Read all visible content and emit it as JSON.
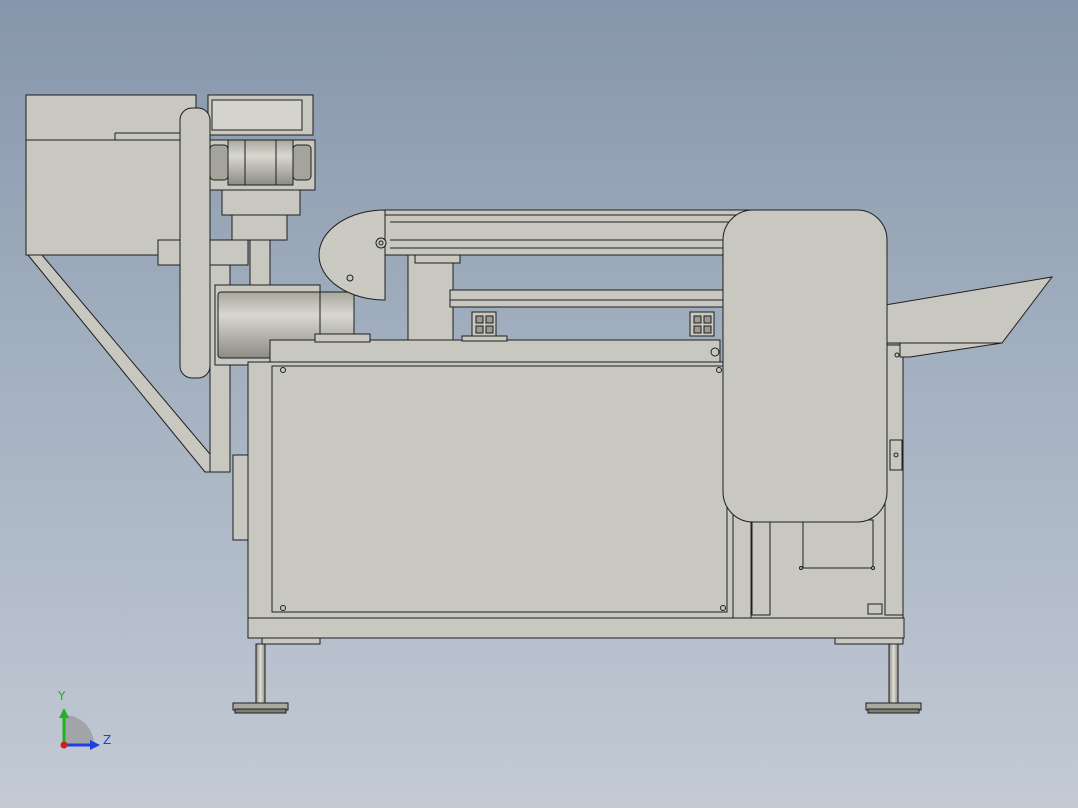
{
  "viewport": {
    "background_top": "#8696ab",
    "background_bottom": "#c3cad4"
  },
  "model": {
    "part_color": "#c8c8c0",
    "part_edge_color": "#1e1e1e",
    "shadow_color": "#9a9a92"
  },
  "triad": {
    "y_label": "Y",
    "z_label": "Z",
    "y_color": "#1fb31f",
    "z_color": "#1f3fdf",
    "x_color": "#d11f1f"
  }
}
